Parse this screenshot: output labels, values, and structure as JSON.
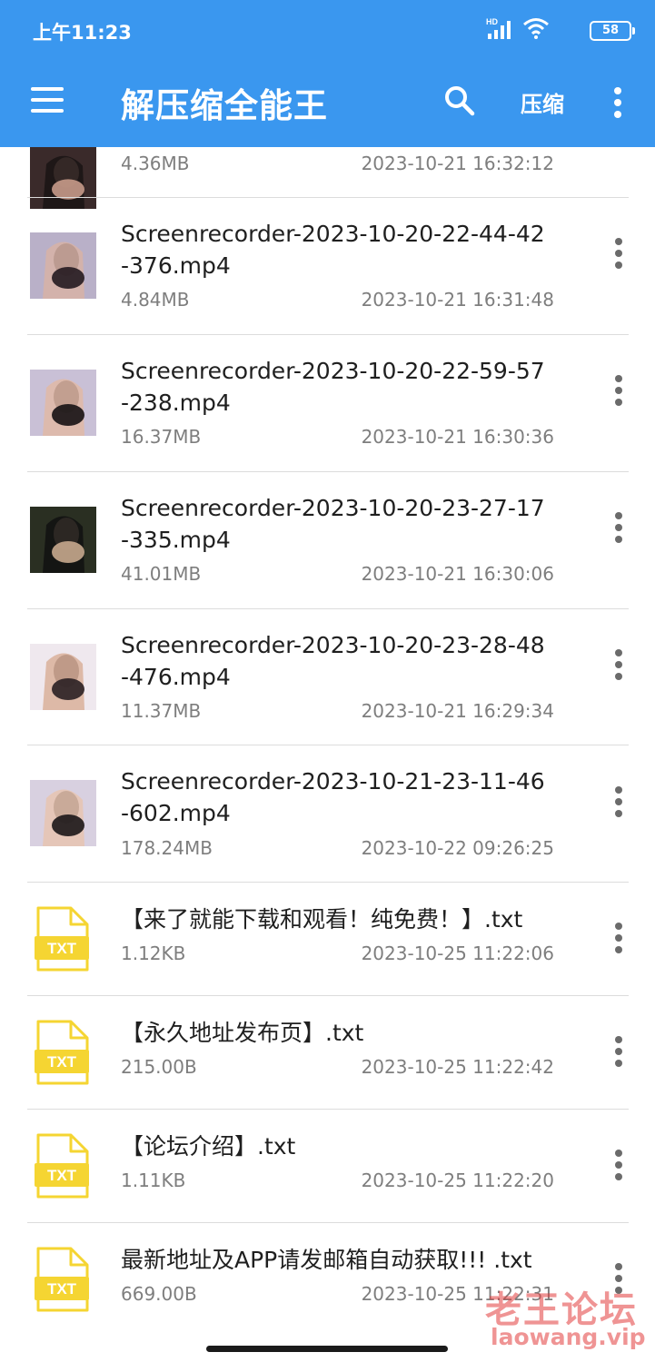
{
  "status_bar": {
    "time": "上午11:23",
    "network": "HD",
    "battery": "58"
  },
  "app_bar": {
    "menu_icon": "menu-icon",
    "title": "解压缩全能王",
    "search_icon": "search-icon",
    "compress_label": "压缩",
    "more_icon": "more-vertical-icon"
  },
  "files": [
    {
      "type": "video",
      "name": "",
      "size": "4.36MB",
      "date": "2023-10-21 16:32:12"
    },
    {
      "type": "video",
      "name": "Screenrecorder-2023-10-20-22-44-42-376.mp4",
      "size": "4.84MB",
      "date": "2023-10-21 16:31:48"
    },
    {
      "type": "video",
      "name": "Screenrecorder-2023-10-20-22-59-57-238.mp4",
      "size": "16.37MB",
      "date": "2023-10-21 16:30:36"
    },
    {
      "type": "video",
      "name": "Screenrecorder-2023-10-20-23-27-17-335.mp4",
      "size": "41.01MB",
      "date": "2023-10-21 16:30:06"
    },
    {
      "type": "video",
      "name": "Screenrecorder-2023-10-20-23-28-48-476.mp4",
      "size": "11.37MB",
      "date": "2023-10-21 16:29:34"
    },
    {
      "type": "video",
      "name": "Screenrecorder-2023-10-21-23-11-46-602.mp4",
      "size": "178.24MB",
      "date": "2023-10-22 09:26:25"
    },
    {
      "type": "txt",
      "icon_label": "TXT",
      "name": "【来了就能下载和观看！纯免费！】.txt",
      "size": "1.12KB",
      "date": "2023-10-25 11:22:06"
    },
    {
      "type": "txt",
      "icon_label": "TXT",
      "name": "【永久地址发布页】.txt",
      "size": "215.00B",
      "date": "2023-10-25 11:22:42"
    },
    {
      "type": "txt",
      "icon_label": "TXT",
      "name": "【论坛介绍】.txt",
      "size": "1.11KB",
      "date": "2023-10-25 11:22:20"
    },
    {
      "type": "txt",
      "icon_label": "TXT",
      "name": "最新地址及APP请发邮箱自动获取!!! .txt",
      "size": "669.00B",
      "date": "2023-10-25 11:22:31"
    }
  ],
  "watermark": {
    "text": "老王论坛",
    "url": "laowang.vip"
  },
  "colors": {
    "accent": "#3a97ef",
    "txt_icon": "#f5d532",
    "divider": "#dcdcdc"
  }
}
